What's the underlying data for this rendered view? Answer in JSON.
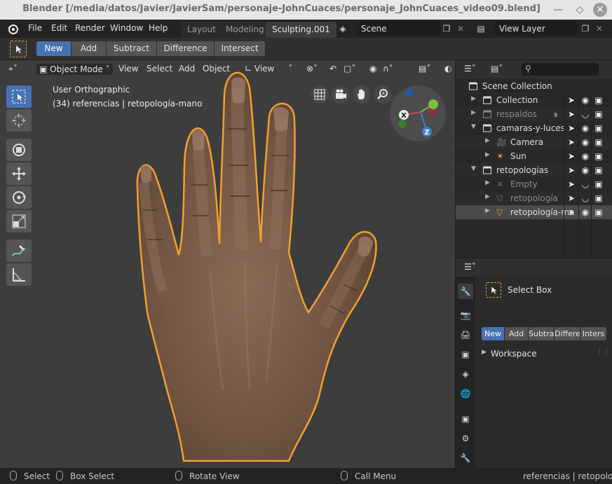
{
  "window": {
    "title": "Blender [/media/datos/Javier/JavierSam/personaje-JohnCuaces/personaje_JohnCuaces_video09.blend]"
  },
  "menubar": {
    "items": [
      "File",
      "Edit",
      "Render",
      "Window",
      "Help"
    ],
    "tabs": [
      {
        "label": "Layout",
        "active": false
      },
      {
        "label": "Modeling",
        "active": false
      },
      {
        "label": "Sculpting.001",
        "active": true
      }
    ],
    "scene": "Scene",
    "view_layer": "View Layer"
  },
  "toolsettings": {
    "modes": [
      {
        "label": "New",
        "active": true
      },
      {
        "label": "Add",
        "active": false
      },
      {
        "label": "Subtract",
        "active": false
      },
      {
        "label": "Difference",
        "active": false
      },
      {
        "label": "Intersect",
        "active": false
      }
    ]
  },
  "viewport": {
    "mode": "Object Mode",
    "menus": [
      "View",
      "Select",
      "Add",
      "Object"
    ],
    "transform_orientation": "View",
    "overlay_title": "User Orthographic",
    "overlay_info": "(34) referencias | retopología-mano",
    "gizmo_axes": {
      "x": "X",
      "z": "Z"
    }
  },
  "outliner": {
    "root": "Scene Collection",
    "rows": [
      {
        "label": "Collection",
        "level": 1,
        "dim": false,
        "expanded": false,
        "type": "collection",
        "selected": false
      },
      {
        "label": "respaldos",
        "level": 1,
        "dim": true,
        "expanded": false,
        "type": "collection",
        "badge": "9",
        "selected": false
      },
      {
        "label": "camaras-y-luces",
        "level": 1,
        "dim": false,
        "expanded": true,
        "type": "collection",
        "selected": false
      },
      {
        "label": "Camera",
        "level": 2,
        "dim": false,
        "type": "camera",
        "selected": false
      },
      {
        "label": "Sun",
        "level": 2,
        "dim": false,
        "type": "light",
        "selected": false
      },
      {
        "label": "retopologías",
        "level": 1,
        "dim": false,
        "expanded": true,
        "type": "collection",
        "selected": false
      },
      {
        "label": "Empty",
        "level": 2,
        "dim": true,
        "type": "empty",
        "selected": false
      },
      {
        "label": "retopología",
        "level": 2,
        "dim": true,
        "type": "mesh",
        "selected": false
      },
      {
        "label": "retopología-ma",
        "level": 2,
        "dim": false,
        "type": "mesh",
        "selected": true
      }
    ]
  },
  "properties": {
    "tool_name": "Select Box",
    "modes": [
      {
        "label": "New",
        "active": true
      },
      {
        "label": "Add",
        "active": false
      },
      {
        "label": "Subtra",
        "active": false
      },
      {
        "label": "Differe",
        "active": false
      },
      {
        "label": "Inters",
        "active": false
      }
    ],
    "panel": "Workspace"
  },
  "statusbar": {
    "select": "Select",
    "box_select": "Box Select",
    "rotate_view": "Rotate View",
    "call_menu": "Call Menu",
    "info": "referencias | retopología-m"
  }
}
